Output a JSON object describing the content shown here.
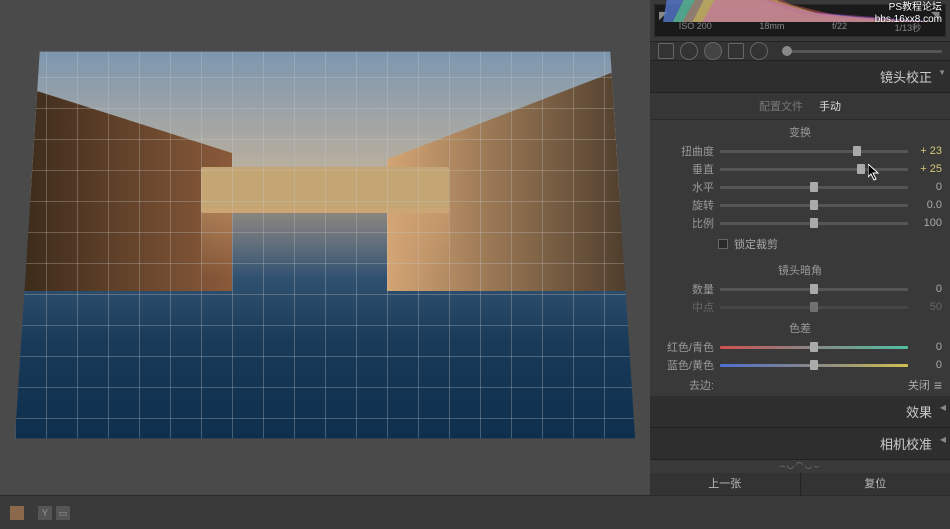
{
  "watermark": {
    "line1": "PS教程论坛",
    "line2": "bbs.16xx8.com"
  },
  "histogram": {
    "iso": "ISO 200",
    "focal": "18mm",
    "aperture": "f/22",
    "shutter": "1/13秒"
  },
  "panels": {
    "lens_correction": "镜头校正",
    "effects": "效果",
    "camera_calibration": "相机校准"
  },
  "tabs": {
    "profile": "配置文件",
    "manual": "手动"
  },
  "transform": {
    "title": "变换",
    "distortion": {
      "label": "扭曲度",
      "value": "+ 23",
      "pos": 73
    },
    "vertical": {
      "label": "垂直",
      "value": "+ 25",
      "pos": 75
    },
    "horizontal": {
      "label": "水平",
      "value": "0",
      "pos": 50
    },
    "rotate": {
      "label": "旋转",
      "value": "0.0",
      "pos": 50
    },
    "scale": {
      "label": "比例",
      "value": "100",
      "pos": 50
    },
    "constrain_crop": "锁定裁剪"
  },
  "vignette": {
    "title": "镜头暗角",
    "amount": {
      "label": "数量",
      "value": "0",
      "pos": 50
    },
    "midpoint": {
      "label": "中点",
      "value": "50",
      "pos": 50
    }
  },
  "chromatic": {
    "title": "色差",
    "red_cyan": {
      "label": "红色/青色",
      "value": "0",
      "pos": 50
    },
    "blue_yellow": {
      "label": "蓝色/黄色",
      "value": "0",
      "pos": 50
    },
    "defringe": {
      "label": "去边:",
      "value": "关闭"
    }
  },
  "nav": {
    "prev": "上一张",
    "reset": "复位"
  },
  "footer": {
    "y": "Y"
  }
}
